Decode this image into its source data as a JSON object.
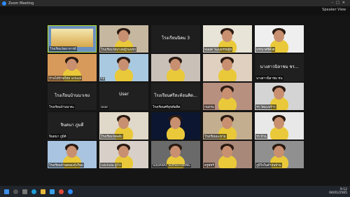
{
  "window": {
    "title": "Zoom Meeting"
  },
  "speaker_view": {
    "label": "Speaker View"
  },
  "tiles": [
    {
      "label": "โรงเรียนวัดอาจารย์",
      "center": "",
      "kind": "slide"
    },
    {
      "label": "โรงเรียนวัดบางหญ้าแพรก",
      "center": "",
      "kind": "photo"
    },
    {
      "label": "",
      "center": "โรงเรียนนิคม 3",
      "kind": "text"
    },
    {
      "label": "พนมศ วัฒนธรรมผู้ช",
      "center": "",
      "kind": "photo"
    },
    {
      "label": "ธรรมาศร์ตั้งศ",
      "center": "",
      "kind": "photo"
    },
    {
      "label": "บ้านไม้บ้านใหม่ school",
      "center": "",
      "kind": "photo"
    },
    {
      "label": "kp",
      "center": "",
      "kind": "photo"
    },
    {
      "label": "",
      "center": "",
      "kind": "photo"
    },
    {
      "label": "",
      "center": "",
      "kind": "photo"
    },
    {
      "label": "นางสาวนิลาชม ชน",
      "center": "นางสาวนิลาชม ชร...",
      "kind": "text"
    },
    {
      "label": "โรงเรียนบ้านนาคะ",
      "center": "โรงเรียนบ้านนาเชง",
      "kind": "text"
    },
    {
      "label": "User",
      "center": "User",
      "kind": "text"
    },
    {
      "label": "โรงเรียนศรีสุขท้อคิด",
      "center": "โรงเรียนศรีสะท้อนคิด...",
      "kind": "text"
    },
    {
      "label": "กนกรม",
      "center": "",
      "kind": "photo"
    },
    {
      "label": "รร.วัดมะพร้าว",
      "center": "",
      "kind": "photo"
    },
    {
      "label": "จินตนา ภูมิดี",
      "center": "จินดนา ภูมดี",
      "kind": "text"
    },
    {
      "label": "โรงเรียนวัดพลับ",
      "center": "",
      "kind": "photo"
    },
    {
      "label": "",
      "center": "",
      "kind": "photo"
    },
    {
      "label": "โรงเรียนมะขาม",
      "center": "",
      "kind": "photo"
    },
    {
      "label": "รร.บ้าน",
      "center": "",
      "kind": "photo"
    },
    {
      "label": "โรงเรียนบ้านคลองกุ้งใหม่",
      "center": "",
      "kind": "photo"
    },
    {
      "label": "ratchida ผู้TH",
      "center": "",
      "kind": "photo"
    },
    {
      "label": "SUDARAT SOYSUTHONG",
      "center": "",
      "kind": "photo"
    },
    {
      "label": "ครูพัชรี",
      "center": "",
      "kind": "photo"
    },
    {
      "label": "ภูมิใจในสำบันบ้าน",
      "center": "",
      "kind": "photo"
    }
  ],
  "taskbar": {
    "time": "9:12",
    "date": "04/01/2565"
  },
  "colors": {
    "active": "#b5e32b",
    "tile_bg": "#2a2a2a",
    "taskbar": "#20242b"
  }
}
